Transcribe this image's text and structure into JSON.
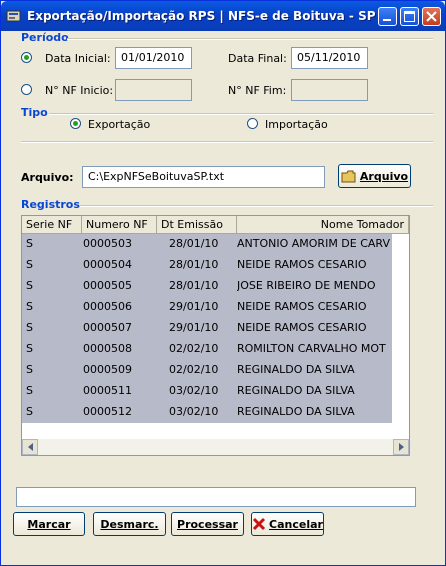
{
  "window": {
    "title": "Exportação/Importação RPS  |  NFS-e de Boituva - SP ..."
  },
  "periodo": {
    "group_label": "Período",
    "data_inicial_label": "Data Inicial:",
    "data_inicial_value": "01/01/2010",
    "data_final_label": "Data Final:",
    "data_final_value": "05/11/2010",
    "nf_inicio_label": "N° NF Inicio:",
    "nf_inicio_value": "",
    "nf_fim_label": "N° NF Fim:",
    "nf_fim_value": ""
  },
  "tipo": {
    "group_label": "Tipo",
    "exportacao_label": "Exportação",
    "importacao_label": "Importação",
    "selected": "Exportação"
  },
  "arquivo": {
    "label": "Arquivo:",
    "path": "C:\\ExpNFSeBoituvaSP.txt",
    "button_label": "Arquivo"
  },
  "registros": {
    "group_label": "Registros",
    "columns": [
      "Serie NF",
      "Numero NF",
      "Dt Emissão",
      "Nome Tomador"
    ],
    "rows": [
      [
        "S",
        "0000503",
        "28/01/10",
        "ANTONIO AMORIM DE CARV"
      ],
      [
        "S",
        "0000504",
        "28/01/10",
        "NEIDE RAMOS CESARIO"
      ],
      [
        "S",
        "0000505",
        "28/01/10",
        " JOSE RIBEIRO DE MENDO"
      ],
      [
        "S",
        "0000506",
        "29/01/10",
        "NEIDE RAMOS CESARIO"
      ],
      [
        "S",
        "0000507",
        "29/01/10",
        "NEIDE RAMOS CESARIO"
      ],
      [
        "S",
        "0000508",
        "02/02/10",
        "ROMILTON CARVALHO MOT"
      ],
      [
        "S",
        "0000509",
        "02/02/10",
        "REGINALDO DA SILVA"
      ],
      [
        "S",
        "0000511",
        "03/02/10",
        "REGINALDO DA SILVA"
      ],
      [
        "S",
        "0000512",
        "03/02/10",
        "REGINALDO DA SILVA"
      ]
    ]
  },
  "status_text": "",
  "buttons": {
    "marcar": "Marcar",
    "desmarcar": "Desmarc.",
    "processar": "Processar",
    "cancelar": "Cancelar"
  },
  "icons": {
    "app": "app-icon",
    "folder": "folder-icon",
    "cancel": "cancel-x-icon"
  }
}
